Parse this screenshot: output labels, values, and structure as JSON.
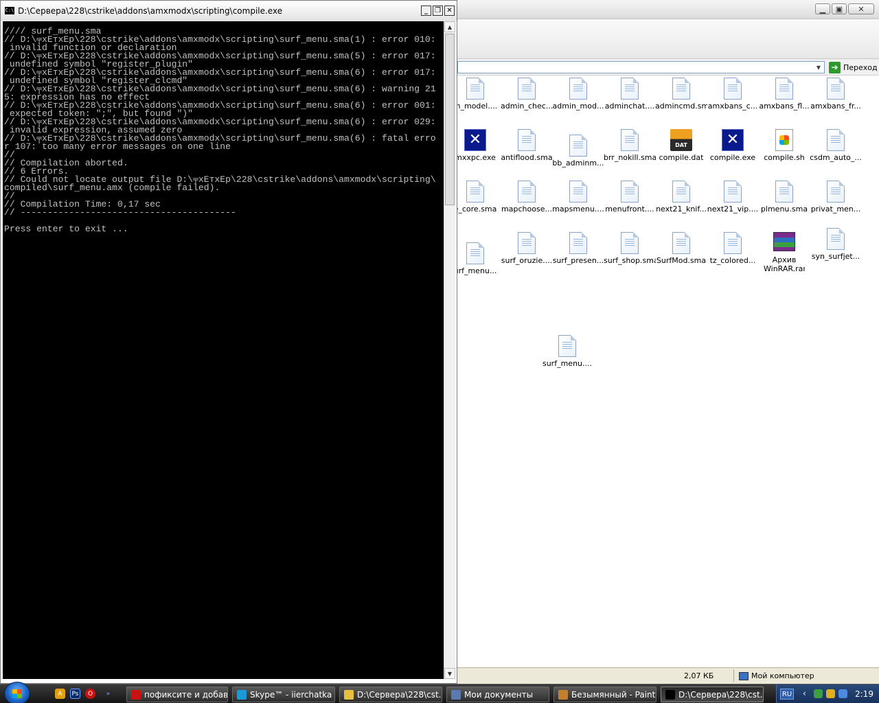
{
  "console": {
    "title": "D:\\Сервера\\228\\cstrike\\addons\\amxmodx\\scripting\\compile.exe",
    "icon_label": "C:\\",
    "lines": [
      "//// surf_menu.sma",
      "// D:\\╤xEтxEp\\228\\cstrike\\addons\\amxmodx\\scripting\\surf_menu.sma(1) : error 010:",
      " invalid function or declaration",
      "// D:\\╤xEтxEp\\228\\cstrike\\addons\\amxmodx\\scripting\\surf_menu.sma(5) : error 017:",
      " undefined symbol \"register_plugin\"",
      "// D:\\╤xEтxEp\\228\\cstrike\\addons\\amxmodx\\scripting\\surf_menu.sma(6) : error 017:",
      " undefined symbol \"register_clcmd\"",
      "// D:\\╤xEтxEp\\228\\cstrike\\addons\\amxmodx\\scripting\\surf_menu.sma(6) : warning 21",
      "5: expression has no effect",
      "// D:\\╤xEтxEp\\228\\cstrike\\addons\\amxmodx\\scripting\\surf_menu.sma(6) : error 001:",
      " expected token: \";\", but found \")\"",
      "// D:\\╤xEтxEp\\228\\cstrike\\addons\\amxmodx\\scripting\\surf_menu.sma(6) : error 029:",
      " invalid expression, assumed zero",
      "// D:\\╤xEтxEp\\228\\cstrike\\addons\\amxmodx\\scripting\\surf_menu.sma(6) : fatal erro",
      "r 107: too many error messages on one line",
      "//",
      "// Compilation aborted.",
      "// 6 Errors.",
      "// Could not locate output file D:\\╤xEтxEp\\228\\cstrike\\addons\\amxmodx\\scripting\\",
      "compiled\\surf_menu.amx (compile failed).",
      "//",
      "// Compilation Time: 0,17 sec",
      "// ----------------------------------------",
      "",
      "Press enter to exit ..."
    ]
  },
  "explorer": {
    "go_label": "Переход",
    "status_size": "2,07 КБ",
    "status_location": "Мой компьютер",
    "files": [
      {
        "name": "m_model....",
        "icon": "doc-icon"
      },
      {
        "name": "admin_chec...",
        "icon": "doc-icon"
      },
      {
        "name": "admin_mod...",
        "icon": "doc-icon"
      },
      {
        "name": "adminchat....",
        "icon": "doc-icon"
      },
      {
        "name": "admincmd.sma",
        "icon": "doc-icon"
      },
      {
        "name": "amxbans_c...",
        "icon": "doc-icon"
      },
      {
        "name": "amxbans_fl...",
        "icon": "doc-icon"
      },
      {
        "name": "amxbans_fr...",
        "icon": "doc-icon"
      },
      {
        "name": "mxxpc.exe",
        "icon": "exe-icon"
      },
      {
        "name": "antiflood.sma",
        "icon": "doc-icon"
      },
      {
        "name": "bb_adminm...",
        "icon": "doc-icon"
      },
      {
        "name": "brr_nokill.sma",
        "icon": "doc-icon"
      },
      {
        "name": "compile.dat",
        "icon": "dat-icon",
        "badge": "DAT"
      },
      {
        "name": "compile.exe",
        "icon": "exe-icon"
      },
      {
        "name": "compile.sh",
        "icon": "sh-icon"
      },
      {
        "name": "csdm_auto_...",
        "icon": "doc-icon"
      },
      {
        "name": "e_core.sma",
        "icon": "doc-icon"
      },
      {
        "name": "mapchoose...",
        "icon": "doc-icon"
      },
      {
        "name": "mapsmenu....",
        "icon": "doc-icon"
      },
      {
        "name": "menufront....",
        "icon": "doc-icon"
      },
      {
        "name": "next21_knif...",
        "icon": "doc-icon"
      },
      {
        "name": "next21_vip....",
        "icon": "doc-icon"
      },
      {
        "name": "plmenu.sma",
        "icon": "doc-icon"
      },
      {
        "name": "privat_men...",
        "icon": "doc-icon"
      },
      {
        "name": "urf_menu...",
        "icon": "doc-icon"
      },
      {
        "name": "surf_oruzie....",
        "icon": "doc-icon"
      },
      {
        "name": "surf_presen...",
        "icon": "doc-icon"
      },
      {
        "name": "surf_shop.sma",
        "icon": "doc-icon"
      },
      {
        "name": "SurfMod.sma",
        "icon": "doc-icon"
      },
      {
        "name": "tz_colored...",
        "icon": "doc-icon"
      },
      {
        "name": "Архив WinRAR.rar",
        "icon": "rar-icon"
      },
      {
        "name": "syn_surfjet...",
        "icon": "doc-icon"
      },
      {
        "name": "surf_menu....",
        "icon": "doc-icon"
      }
    ]
  },
  "taskbar": {
    "items": [
      {
        "label": "пофиксите и добав...",
        "icon": "opera-icon",
        "color": "#cc1111"
      },
      {
        "label": "Skype™ - iierchatka",
        "icon": "skype-icon",
        "color": "#1a9bd7"
      },
      {
        "label": "D:\\Сервера\\228\\cst...",
        "icon": "folder-icon",
        "color": "#e8c040"
      },
      {
        "label": "Мои документы",
        "icon": "documents-icon",
        "color": "#5a7ab0"
      },
      {
        "label": "Безымянный - Paint",
        "icon": "paint-icon",
        "color": "#c08030"
      },
      {
        "label": "D:\\Сервера\\228\\cst...",
        "icon": "console-icon",
        "color": "#000000"
      }
    ],
    "lang": "RU",
    "clock": "2:19"
  }
}
